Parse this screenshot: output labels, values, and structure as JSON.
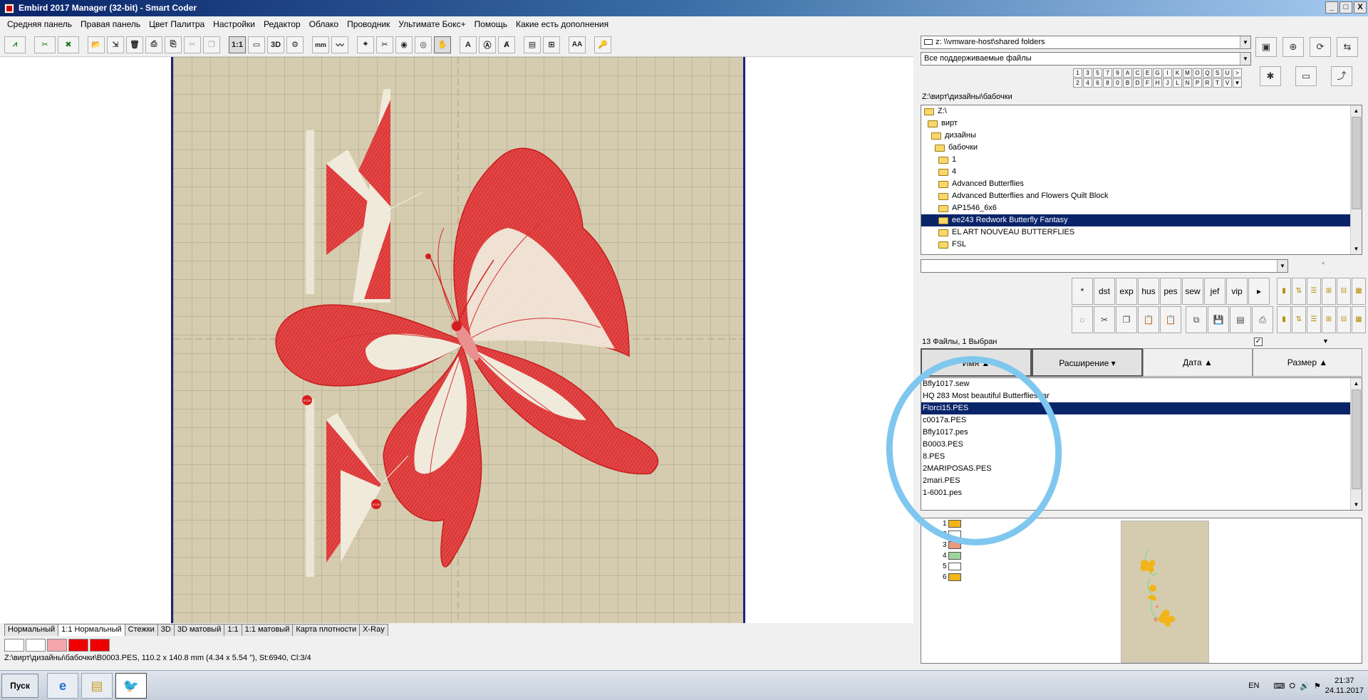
{
  "window": {
    "title": "Embird 2017 Manager (32-bit) - Smart Coder",
    "minimize": "_",
    "restore": "□",
    "close": "X"
  },
  "menu": [
    "Средняя панель",
    "Правая панель",
    "Цвет Палитра",
    "Настройки",
    "Редактор",
    "Облако",
    "Проводник",
    "Ультимате Бокс+",
    "Помощь",
    "Какие есть дополнения"
  ],
  "toolbar": {
    "buttons": [
      "1:1",
      "3D",
      "mm",
      "A",
      "AA"
    ]
  },
  "design": {
    "stop_marker": "STOP",
    "thread_colors": [
      "#ffffff",
      "#ffffff",
      "#f4a6ac",
      "#ee0000",
      "#ee0000"
    ]
  },
  "view_tabs": [
    "Нормальный",
    "1:1 Нормальный",
    "Стежки",
    "3D",
    "3D матовый",
    "1:1",
    "1:1 матовый",
    "Карта плотности",
    "X-Ray"
  ],
  "view_tabs_active": 1,
  "status": "Z:\\вирт\\дизайны\\бабочки\\B0003.PES, 110.2 x 140.8 mm (4.34 x 5.54 \"), St:6940, Cl:3/4",
  "explorer": {
    "drive": "z: \\\\vmware-host\\shared folders",
    "filter": "Все поддерживаемые файлы",
    "letters_row1": [
      "1",
      "3",
      "5",
      "7",
      "9",
      "A",
      "C",
      "E",
      "G",
      "I",
      "K",
      "M",
      "O",
      "Q",
      "S",
      "U",
      ">"
    ],
    "letters_row2": [
      "2",
      "4",
      "6",
      "8",
      "0",
      "B",
      "D",
      "F",
      "H",
      "J",
      "L",
      "N",
      "P",
      "R",
      "T",
      "V",
      "▼"
    ],
    "current_path": "Z:\\вирт\\дизайны\\бабочки",
    "tree": [
      {
        "label": "Z:\\",
        "indent": 0,
        "open": true
      },
      {
        "label": "вирт",
        "indent": 1,
        "open": true
      },
      {
        "label": "дизайны",
        "indent": 2,
        "open": true
      },
      {
        "label": "бабочки",
        "indent": 3,
        "open": true
      },
      {
        "label": "1",
        "indent": 4
      },
      {
        "label": "4",
        "indent": 4
      },
      {
        "label": "Advanced  Butterflies",
        "indent": 4
      },
      {
        "label": "Advanced  Butterflies and Flowers Quilt Block",
        "indent": 4
      },
      {
        "label": "AP1546_6x6",
        "indent": 4
      },
      {
        "label": "ee243 Redwork Butterfly Fantasy",
        "indent": 4,
        "selected": true
      },
      {
        "label": "EL ART NOUVEAU BUTTERFLIES",
        "indent": 4
      },
      {
        "label": "FSL",
        "indent": 4
      }
    ],
    "search_placeholder": "",
    "asterisk": "*",
    "formats": [
      "*",
      "dst",
      "exp",
      "hus",
      "pes",
      "sew",
      "jef",
      "vip",
      "▸"
    ],
    "file_count": "13 Файлы, 1 Выбран",
    "columns": [
      "Имя ▲",
      "Расширение ▾",
      "Дата ▲",
      "Размер ▲"
    ],
    "files": [
      {
        "name": "Bfly1017.sew"
      },
      {
        "name": "HQ 283 Most beautiful Butterflies.rar"
      },
      {
        "name": "Florci15.PES",
        "selected": true
      },
      {
        "name": "c0017a.PES"
      },
      {
        "name": "Bfly1017.pes"
      },
      {
        "name": "B0003.PES"
      },
      {
        "name": "8.PES"
      },
      {
        "name": "2MARIPOSAS.PES"
      },
      {
        "name": "2mari.PES"
      },
      {
        "name": "1-6001.pes"
      }
    ],
    "preview_colors": [
      {
        "n": "1",
        "color": "#f2b418"
      },
      {
        "n": "2",
        "color": "#ffffff"
      },
      {
        "n": "3",
        "color": "#e89a7c"
      },
      {
        "n": "4",
        "color": "#9fd49a"
      },
      {
        "n": "5",
        "color": "#ffffff"
      },
      {
        "n": "6",
        "color": "#f2b418"
      }
    ]
  },
  "taskbar": {
    "start": "Пуск",
    "lang": "EN",
    "time": "21:37",
    "date": "24.11.2017"
  }
}
